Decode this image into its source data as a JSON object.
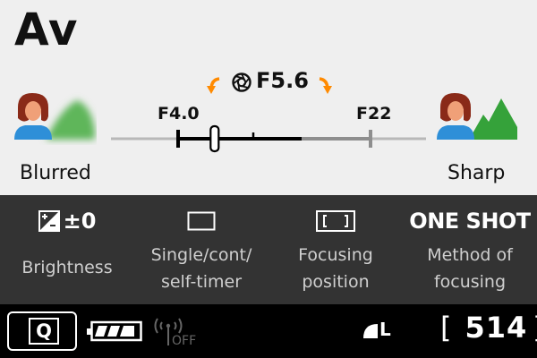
{
  "mode": "Av",
  "aperture": {
    "value": "F5.6",
    "min": "F4.0",
    "max": "F22",
    "level": 0.19
  },
  "ends": {
    "left": "Blurred",
    "right": "Sharp"
  },
  "settings": [
    {
      "value": "±0",
      "caption_lines": [
        "Brightness"
      ]
    },
    {
      "value": "",
      "caption_lines": [
        "Single/cont/",
        "self-timer"
      ]
    },
    {
      "value": "",
      "caption_lines": [
        "Focusing",
        "position"
      ]
    },
    {
      "value": "ONE SHOT",
      "caption_lines": [
        "Method of",
        "focusing"
      ]
    }
  ],
  "status": {
    "quick_button": "Q",
    "wifi": "OFF",
    "quality": "L",
    "shots_remaining": "514",
    "bracket_open": "[",
    "bracket_close": "]"
  },
  "icons": [
    "aperture-icon",
    "person-blurred-icon",
    "person-sharp-icon",
    "exposure-comp-icon",
    "drive-mode-icon",
    "af-frame-icon",
    "battery-icon",
    "wifi-off-icon",
    "quality-icon"
  ],
  "colors": {
    "accent": "#ff8a00",
    "top_bg": "#efefef",
    "mid_bg": "#333333",
    "bottom_bg": "#000000"
  }
}
